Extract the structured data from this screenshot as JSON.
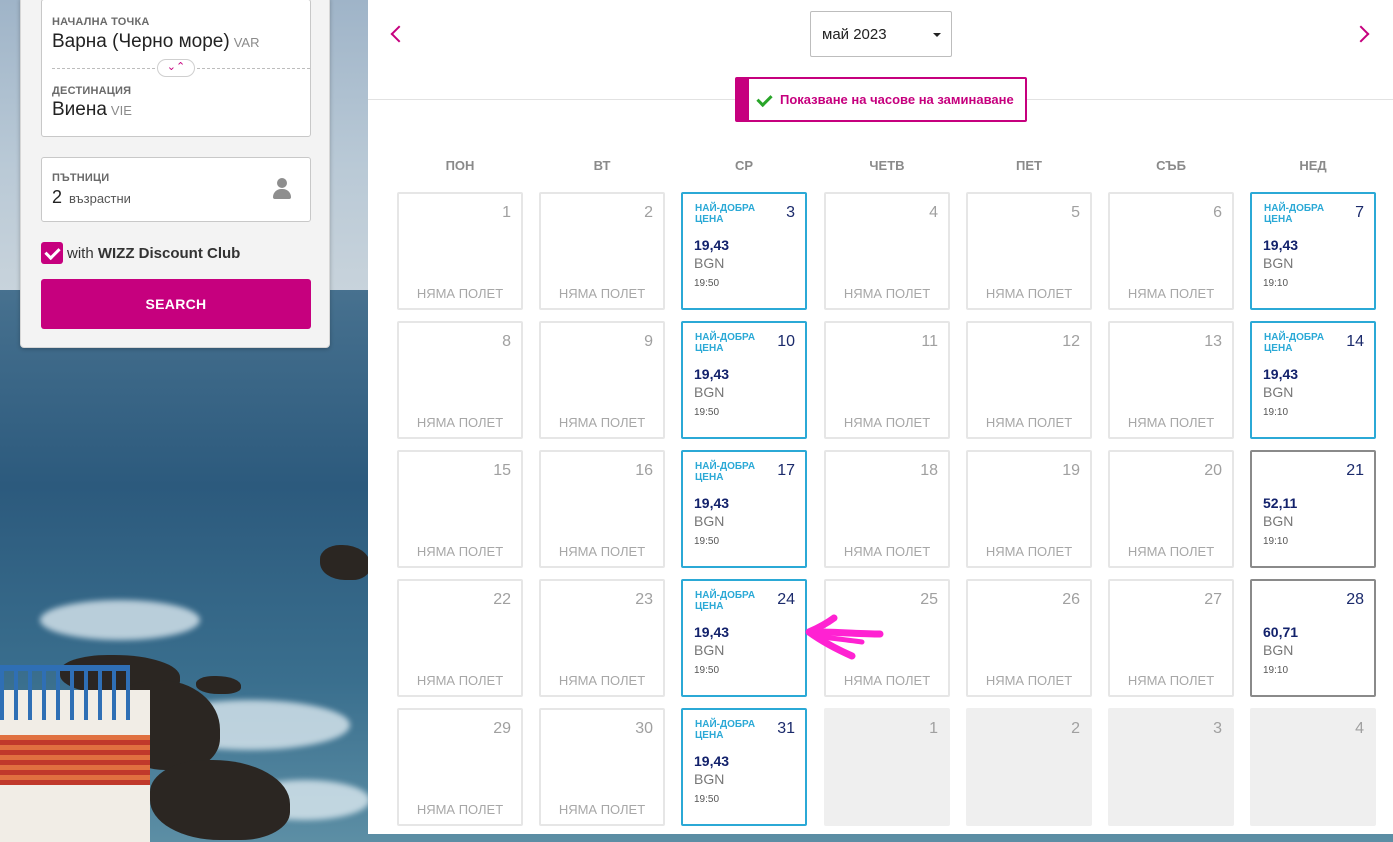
{
  "search_panel": {
    "origin_label": "НАЧАЛНА ТОЧКА",
    "origin_city": "Варна (Черно море)",
    "origin_code": "VAR",
    "destination_label": "ДЕСТИНАЦИЯ",
    "destination_city": "Виена",
    "destination_code": "VIE",
    "swap_glyph": "⌄⌃",
    "passengers_label": "ПЪТНИЦИ",
    "passengers_count": "2",
    "passengers_type": "възрастни",
    "club_prefix": "with",
    "club_name": "WIZZ Discount Club",
    "club_checked": true,
    "search_button": "SEARCH"
  },
  "calendar": {
    "month": "май 2023",
    "toggle_label": "Показване на часове на заминаване",
    "toggle_on": true,
    "weekdays": [
      "ПОН",
      "ВТ",
      "СР",
      "ЧЕТВ",
      "ПЕТ",
      "СЪБ",
      "НЕД"
    ],
    "no_flight_label": "НЯМА ПОЛЕТ",
    "best_price_label": "НАЙ-ДОБРА ЦЕНА",
    "days": [
      {
        "day": "1",
        "status": "none"
      },
      {
        "day": "2",
        "status": "none"
      },
      {
        "day": "3",
        "status": "best",
        "price": "19,43",
        "currency": "BGN",
        "time": "19:50"
      },
      {
        "day": "4",
        "status": "none"
      },
      {
        "day": "5",
        "status": "none"
      },
      {
        "day": "6",
        "status": "none"
      },
      {
        "day": "7",
        "status": "best",
        "price": "19,43",
        "currency": "BGN",
        "time": "19:10"
      },
      {
        "day": "8",
        "status": "none"
      },
      {
        "day": "9",
        "status": "none"
      },
      {
        "day": "10",
        "status": "best",
        "price": "19,43",
        "currency": "BGN",
        "time": "19:50"
      },
      {
        "day": "11",
        "status": "none"
      },
      {
        "day": "12",
        "status": "none"
      },
      {
        "day": "13",
        "status": "none"
      },
      {
        "day": "14",
        "status": "best",
        "price": "19,43",
        "currency": "BGN",
        "time": "19:10"
      },
      {
        "day": "15",
        "status": "none"
      },
      {
        "day": "16",
        "status": "none"
      },
      {
        "day": "17",
        "status": "best",
        "price": "19,43",
        "currency": "BGN",
        "time": "19:50"
      },
      {
        "day": "18",
        "status": "none"
      },
      {
        "day": "19",
        "status": "none"
      },
      {
        "day": "20",
        "status": "none"
      },
      {
        "day": "21",
        "status": "flight",
        "price": "52,11",
        "currency": "BGN",
        "time": "19:10"
      },
      {
        "day": "22",
        "status": "none"
      },
      {
        "day": "23",
        "status": "none"
      },
      {
        "day": "24",
        "status": "best",
        "price": "19,43",
        "currency": "BGN",
        "time": "19:50"
      },
      {
        "day": "25",
        "status": "none"
      },
      {
        "day": "26",
        "status": "none"
      },
      {
        "day": "27",
        "status": "none"
      },
      {
        "day": "28",
        "status": "flight",
        "price": "60,71",
        "currency": "BGN",
        "time": "19:10"
      },
      {
        "day": "29",
        "status": "none"
      },
      {
        "day": "30",
        "status": "none"
      },
      {
        "day": "31",
        "status": "best",
        "price": "19,43",
        "currency": "BGN",
        "time": "19:50"
      },
      {
        "day": "1",
        "status": "outside"
      },
      {
        "day": "2",
        "status": "outside"
      },
      {
        "day": "3",
        "status": "outside"
      },
      {
        "day": "4",
        "status": "outside"
      }
    ]
  },
  "colors": {
    "brand": "#c6007e",
    "best_price": "#2ba9d6",
    "price_text": "#12216b",
    "check": "#29a529"
  }
}
